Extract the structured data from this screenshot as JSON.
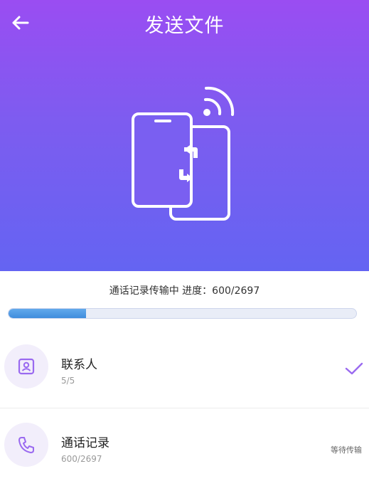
{
  "header": {
    "title": "发送文件",
    "back_icon": "arrow-left-icon"
  },
  "progress": {
    "label": "通话记录传输中 进度：600/2697",
    "current": 600,
    "total": 2697,
    "fill_color": "#4a97e3"
  },
  "items": [
    {
      "icon": "contact-card-icon",
      "title": "联系人",
      "subtitle": "5/5",
      "status_icon": "check-icon"
    },
    {
      "icon": "phone-icon",
      "title": "通话记录",
      "subtitle": "600/2697",
      "status": "等待传输"
    }
  ],
  "colors": {
    "gradient_top": "#9a4df2",
    "gradient_bottom": "#6464f2",
    "accent": "#9a6af0"
  }
}
